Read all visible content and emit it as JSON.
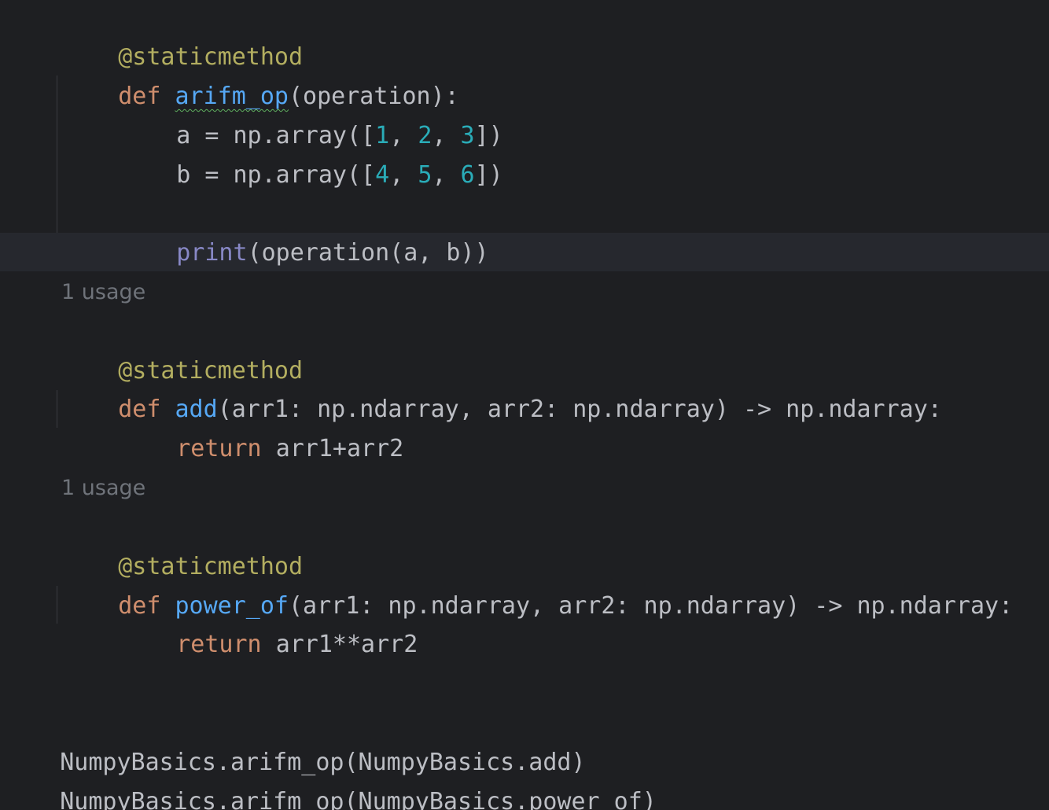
{
  "code": {
    "line1": {
      "decorator": "@staticmethod"
    },
    "line2": {
      "kw": "def ",
      "fn": "arifm_op",
      "rest": "(operation):"
    },
    "line3": {
      "pre": "a = np.array([",
      "n1": "1",
      "s1": ", ",
      "n2": "2",
      "s2": ", ",
      "n3": "3",
      "post": "])"
    },
    "line4": {
      "pre": "b = np.array([",
      "n1": "4",
      "s1": ", ",
      "n2": "5",
      "s2": ", ",
      "n3": "6",
      "post": "])"
    },
    "line6": {
      "builtin": "print",
      "rest": "(operation(a, b))"
    },
    "hint1": "1 usage",
    "line9": {
      "decorator": "@staticmethod"
    },
    "line10": {
      "kw": "def ",
      "fn": "add",
      "rest": "(arr1: np.ndarray, arr2: np.ndarray) -> np.ndarray:"
    },
    "line11": {
      "kw": "return ",
      "rest": "arr1+arr2"
    },
    "hint2": "1 usage",
    "line14": {
      "decorator": "@staticmethod"
    },
    "line15": {
      "kw": "def ",
      "fn": "power_of",
      "rest": "(arr1: np.ndarray, arr2: np.ndarray) -> np.ndarray:"
    },
    "line16": {
      "kw": "return ",
      "rest": "arr1**arr2"
    },
    "line19": "NumpyBasics.arifm_op(NumpyBasics.add)",
    "line20": "NumpyBasics.arifm_op(NumpyBasics.power_of)"
  },
  "colors": {
    "background": "#1e1f22",
    "current_line": "#26282e",
    "keyword": "#cf8e6d",
    "decorator": "#b3ae60",
    "function": "#56a8f5",
    "number": "#2aacb8",
    "builtin": "#8888c6",
    "text": "#bcbec4",
    "hint": "#6f737a"
  }
}
